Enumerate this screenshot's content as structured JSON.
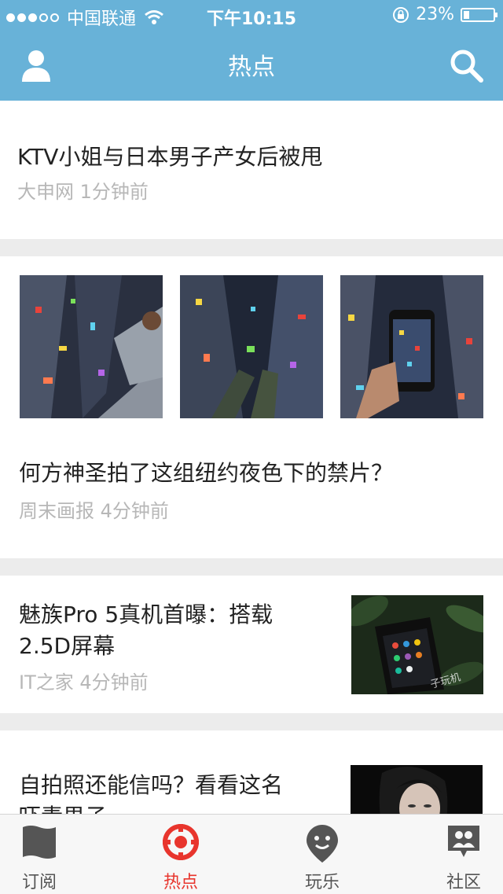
{
  "status_bar": {
    "carrier": "中国联通",
    "time": "下午10:15",
    "battery": "23%"
  },
  "header": {
    "title": "热点"
  },
  "feed": [
    {
      "title": "KTV小姐与日本男子产女后被甩",
      "source": "大申网",
      "time": "1分钟前"
    },
    {
      "title": "何方神圣拍了这组纽约夜色下的禁片？",
      "source": "周末画报",
      "time": "4分钟前",
      "images": [
        "rooftop-sitting-photo",
        "dangling-legs-photo",
        "phone-over-city-photo"
      ]
    },
    {
      "title_lines": [
        "魅族Pro 5真机首曝：搭载",
        "2.5D屏幕"
      ],
      "source": "IT之家",
      "time": "4分钟前",
      "image": "phone-in-leaves-photo",
      "image_watermark": "子玩机"
    },
    {
      "title_lines": [
        "自拍照还能信吗？看看这名",
        "吓素男子"
      ],
      "image": "woman-portrait-photo"
    }
  ],
  "tabs": [
    {
      "label": "订阅",
      "icon": "flag-icon",
      "active": false
    },
    {
      "label": "热点",
      "icon": "target-icon",
      "active": true
    },
    {
      "label": "玩乐",
      "icon": "location-face-icon",
      "active": false
    },
    {
      "label": "社区",
      "icon": "community-icon",
      "active": false
    }
  ],
  "colors": {
    "header": "#68b2d8",
    "accent": "#e8352d",
    "divider": "#ececec"
  }
}
